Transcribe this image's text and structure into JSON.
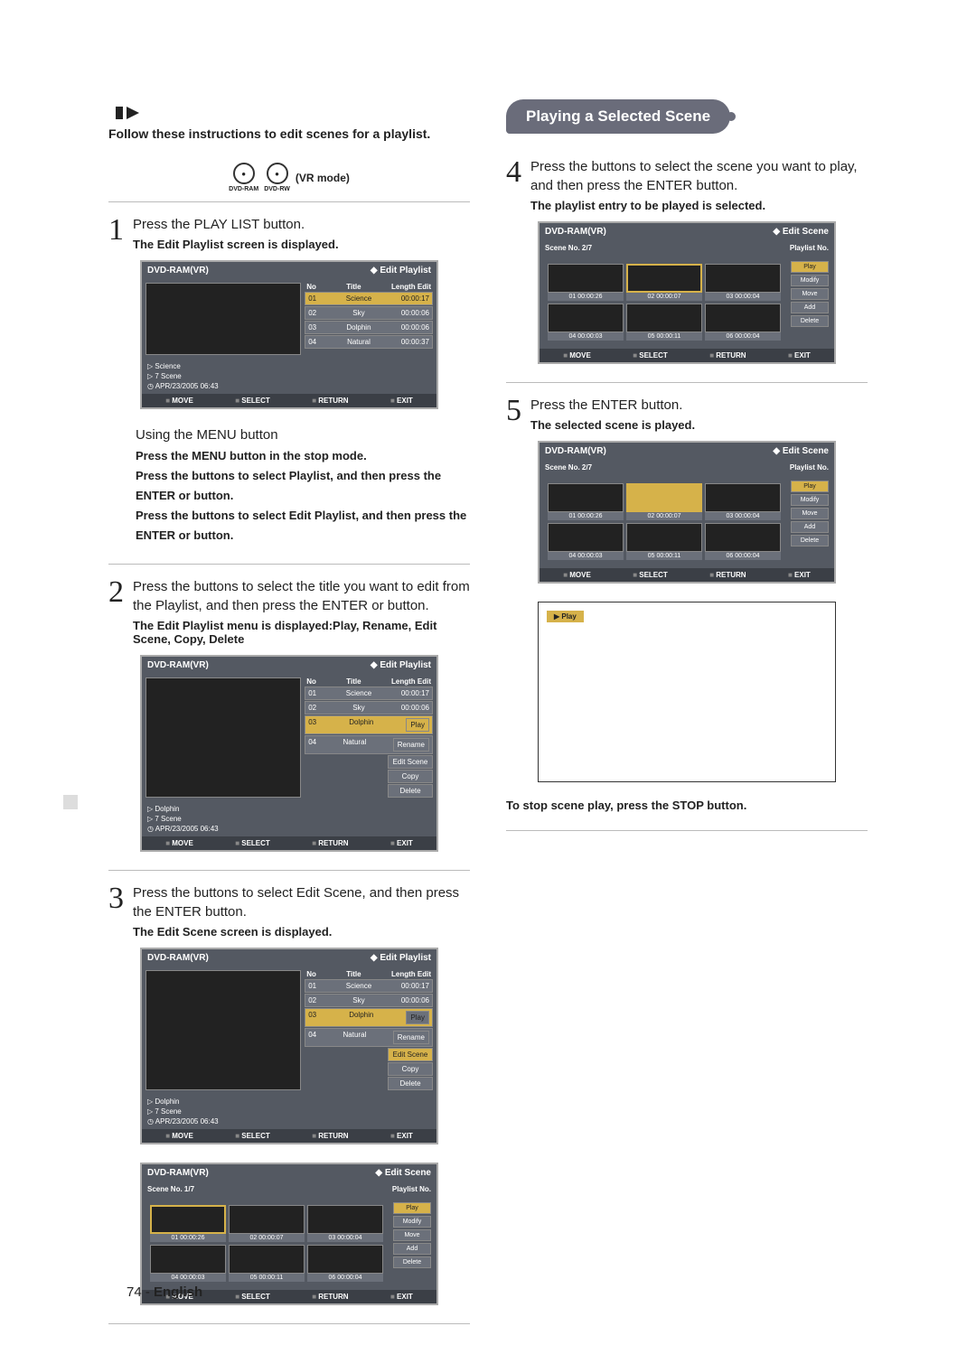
{
  "intro": "Follow these instructions to edit scenes for a playlist.",
  "disc_labels": {
    "ram": "DVD-RAM",
    "rw": "DVD-RW",
    "vr": "(VR mode)"
  },
  "step1": {
    "num": "1",
    "text": "Press the PLAY LIST button.",
    "bold": "The Edit Playlist screen is displayed."
  },
  "menu_sub": {
    "head": "Using the MENU button",
    "b1": "Press the MENU button in the stop mode.",
    "b2": "Press the      buttons to select Playlist, and then press the ENTER or      button.",
    "b3": "Press the      buttons to select Edit Playlist, and then press the ENTER or      button."
  },
  "step2": {
    "num": "2",
    "text": "Press the      buttons to select the title you want to edit from the Playlist, and then press the ENTER or     button.",
    "bold": "The Edit Playlist menu is displayed:Play, Rename, Edit Scene, Copy, Delete"
  },
  "step3": {
    "num": "3",
    "text": "Press the      buttons to select Edit Scene, and then press the ENTER button.",
    "bold": "The Edit Scene screen is displayed."
  },
  "heading_right": "Playing a Selected Scene",
  "step4": {
    "num": "4",
    "text": "Press the         buttons to select the scene you want to play, and then press the ENTER button.",
    "bold": "The playlist entry to be played is selected."
  },
  "step5": {
    "num": "5",
    "text": "Press the ENTER button.",
    "bold": "The selected scene is played."
  },
  "stop_note": "To stop scene play, press the STOP button.",
  "pagenum": {
    "n": "74 - ",
    "l": "English"
  },
  "scr_common": {
    "title_left": "DVD-RAM(VR)",
    "title_right": "Edit Playlist",
    "title_scene": "Edit Scene",
    "no_head": "No",
    "title_head": "Title",
    "len_head": "Length  Edit",
    "rows": [
      {
        "n": "01",
        "t": "Science",
        "l": "00:00:17"
      },
      {
        "n": "02",
        "t": "Sky",
        "l": "00:00:06"
      },
      {
        "n": "03",
        "t": "Dolphin",
        "l": "00:00:06"
      },
      {
        "n": "04",
        "t": "Natural",
        "l": "00:00:37"
      }
    ],
    "menu_items": [
      "Play",
      "Rename",
      "Edit Scene",
      "Copy",
      "Delete"
    ],
    "footer": [
      "MOVE",
      "SELECT",
      "RETURN",
      "EXIT"
    ],
    "info1_title": "Science",
    "info1_scene": "7 Scene",
    "info2_title": "Dolphin",
    "info2_scene": "7 Scene",
    "info_date": "APR/23/2005 06:43",
    "scene_header_l": "Scene No.",
    "scene_header_r": "Playlist No.",
    "scene_count": "2/7",
    "scene_count3": "1/7",
    "thumbs": [
      {
        "n": "01",
        "t": "00:00:26"
      },
      {
        "n": "02",
        "t": "00:00:07"
      },
      {
        "n": "03",
        "t": "00:00:04"
      },
      {
        "n": "04",
        "t": "00:00:03"
      },
      {
        "n": "05",
        "t": "00:00:11"
      },
      {
        "n": "06",
        "t": "00:00:04"
      }
    ],
    "rbtns": [
      "Play",
      "Modify",
      "Move",
      "Add",
      "Delete"
    ]
  },
  "play_tag": "▶ Play"
}
